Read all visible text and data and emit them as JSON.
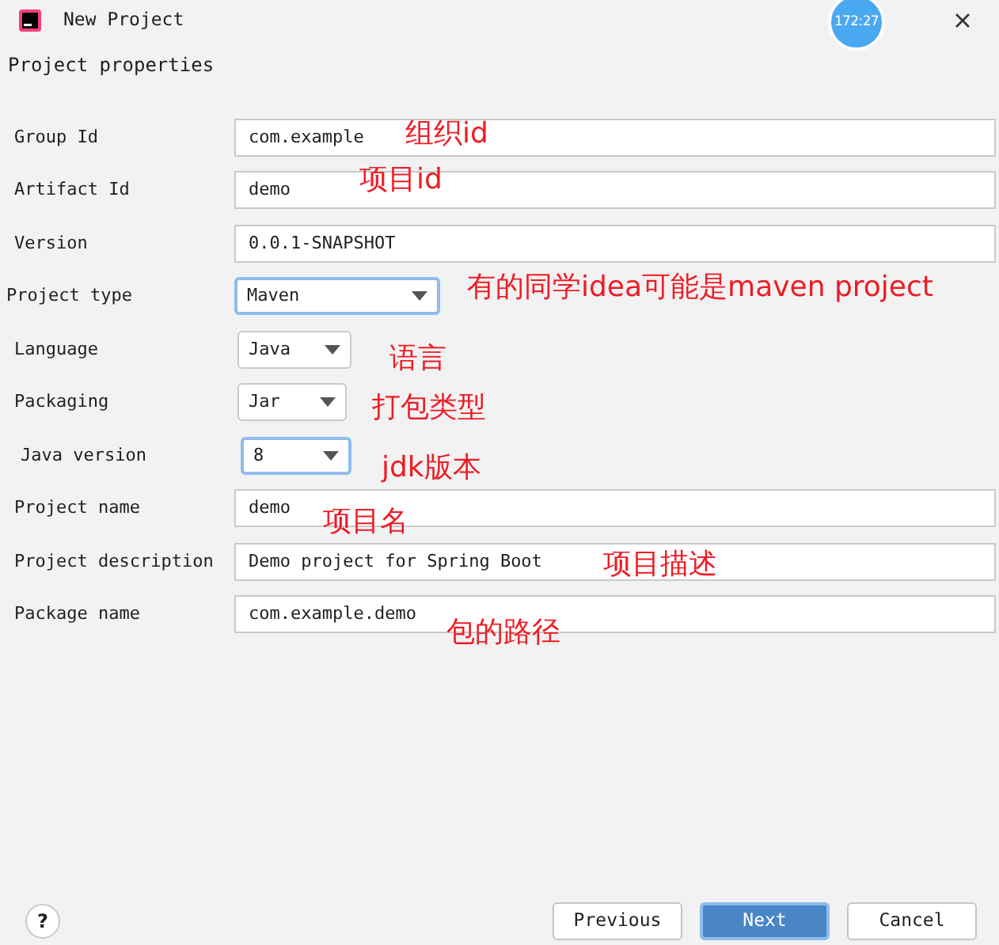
{
  "window": {
    "title": "New Project",
    "clock": "172:27"
  },
  "section_title": "Project properties",
  "fields": [
    {
      "kind": "text",
      "label": "Group Id",
      "value": "com.example"
    },
    {
      "kind": "text",
      "label": "Artifact Id",
      "value": "demo"
    },
    {
      "kind": "text",
      "label": "Version",
      "value": "0.0.1-SNAPSHOT"
    },
    {
      "kind": "dropdown",
      "label": "Project type",
      "value": "Maven",
      "highlighted": true
    },
    {
      "kind": "dropdown",
      "label": "Language",
      "value": "Java",
      "highlighted": false
    },
    {
      "kind": "dropdown",
      "label": "Packaging",
      "value": "Jar",
      "highlighted": false
    },
    {
      "kind": "dropdown",
      "label": "Java version",
      "value": "8",
      "highlighted": true
    },
    {
      "kind": "text",
      "label": "Project name",
      "value": "demo"
    },
    {
      "kind": "text",
      "label": "Project description",
      "value": "Demo project for Spring Boot"
    },
    {
      "kind": "text",
      "label": "Package name",
      "value": "com.example.demo"
    }
  ],
  "annotations": [
    "组织id",
    "项目id",
    "有的同学idea可能是maven project",
    "语言",
    "打包类型",
    "jdk版本",
    "项目名",
    "项目描述",
    "包的路径"
  ],
  "buttons": [
    {
      "label": "Previous",
      "primary": false
    },
    {
      "label": "Next",
      "primary": true
    },
    {
      "label": "Cancel",
      "primary": false
    }
  ],
  "help": "?"
}
